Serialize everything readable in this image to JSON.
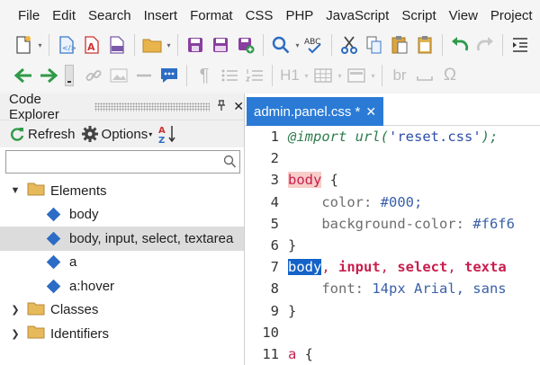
{
  "menu": [
    "File",
    "Edit",
    "Search",
    "Insert",
    "Format",
    "CSS",
    "PHP",
    "JavaScript",
    "Script",
    "View",
    "Project"
  ],
  "toolbar1": [
    "new-file-icon",
    "html-doc-icon",
    "pdf-icon",
    "php-icon",
    "open-folder-icon",
    "save-icon",
    "save-all-icon",
    "save-plus-icon",
    "search-icon",
    "spell-check-icon",
    "cut-icon",
    "copy-icon",
    "paste-icon",
    "clipboard-icon",
    "undo-icon",
    "redo-icon",
    "indent-icon"
  ],
  "toolbar2": [
    "back-arrow-icon",
    "forward-arrow-icon",
    "link-icon",
    "image-icon",
    "horizontal-rule-icon",
    "comment-icon",
    "paragraph-icon",
    "list-icon",
    "numbered-list-icon",
    "heading-icon",
    "table-icon",
    "form-icon",
    "line-break-icon",
    "space-icon",
    "omega-icon"
  ],
  "toolbar2_text": {
    "heading": "H1",
    "br": "br",
    "omega": "Ω",
    "paragraph": "¶"
  },
  "explorer": {
    "title": "Code Explorer",
    "refresh_label": "Refresh",
    "options_label": "Options",
    "search_value": "",
    "tree": [
      {
        "label": "Elements",
        "expanded": true,
        "children": [
          "body",
          "body, input, select, textarea",
          "a",
          "a:hover"
        ]
      },
      {
        "label": "Classes",
        "expanded": false
      },
      {
        "label": "Identifiers",
        "expanded": false
      }
    ],
    "selected": "body, input, select, textarea"
  },
  "editor": {
    "tab_label": "admin.panel.css *",
    "lines": [
      {
        "n": "1",
        "text": "@import url('reset.css');"
      },
      {
        "n": "2",
        "text": ""
      },
      {
        "n": "3",
        "text": "body {"
      },
      {
        "n": "4",
        "text": "    color: #000;"
      },
      {
        "n": "5",
        "text": "    background-color: #f6f6"
      },
      {
        "n": "6",
        "text": "}"
      },
      {
        "n": "7",
        "text": "body, input, select, texta"
      },
      {
        "n": "8",
        "text": "    font: 14px Arial, sans"
      },
      {
        "n": "9",
        "text": "}"
      },
      {
        "n": "10",
        "text": ""
      },
      {
        "n": "11",
        "text": "a {"
      }
    ]
  },
  "colors": {
    "accent": "#2b7bd6",
    "selector": "#c81e4c",
    "selection": "#1463c8",
    "match": "#f7cdc9",
    "diamond": "#2c6cc4"
  }
}
